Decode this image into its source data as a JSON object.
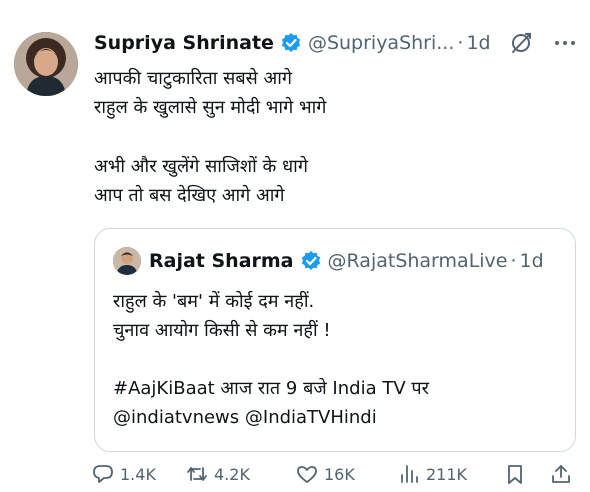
{
  "tweet": {
    "author_name": "Supriya Shrinate",
    "handle": "@SupriyaShri...",
    "separator": "·",
    "time": "1d",
    "lines": [
      "आपकी चाटुकारिता सबसे आगे",
      "राहुल के खुलासे सुन मोदी भागे भागे",
      "अभी और खुलेंगे साजिशों के धागे",
      "आप तो बस देखिए आगे आगे"
    ]
  },
  "quote": {
    "author_name": "Rajat Sharma",
    "handle": "@RajatSharmaLive",
    "separator": "·",
    "time": "1d",
    "lines": [
      "राहुल के 'बम' में कोई दम नहीं.",
      "चुनाव आयोग किसी से कम नहीं !",
      "#AajKiBaat आज रात 9 बजे India TV पर",
      "@indiatvnews  @IndiaTVHindi"
    ]
  },
  "actions": {
    "replies": "1.4K",
    "reposts": "4.2K",
    "likes": "16K",
    "views": "211K"
  },
  "colors": {
    "text": "#0f1419",
    "secondary": "#536471",
    "verified": "#1d9bf0",
    "border": "#cfd9de"
  },
  "icons": [
    "verified-badge-icon",
    "grok-icon",
    "more-icon",
    "reply-icon",
    "repost-icon",
    "like-icon",
    "views-icon",
    "bookmark-icon",
    "share-icon"
  ]
}
